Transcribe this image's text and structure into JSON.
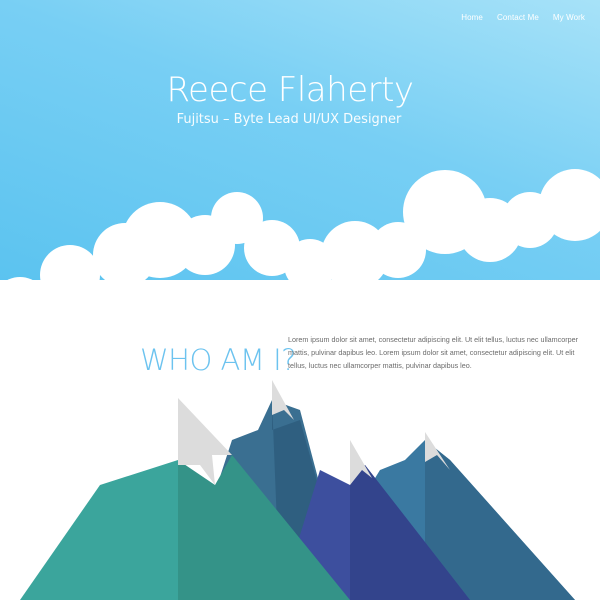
{
  "nav": {
    "items": [
      "Home",
      "Contact Me",
      "My Work"
    ]
  },
  "header": {
    "name": "Reece Flaherty",
    "role": "Fujitsu – Byte Lead UI/UX Designer"
  },
  "about": {
    "heading": "WHO AM I?",
    "text": "Lorem ipsum dolor sit amet, consectetur adipiscing elit. Ut elit tellus, luctus nec ullamcorper mattis, pulvinar dapibus leo. Lorem ipsum dolor sit amet, consectetur adipiscing elit. Ut elit tellus, luctus nec ullamcorper mattis, pulvinar dapibus leo."
  },
  "colors": {
    "sky_light": "#a7e2f8",
    "sky_dark": "#56c1ef",
    "heading_blue": "#6cc3ef",
    "mountain_teal": "#3ba59c",
    "mountain_blue": "#3a79a1",
    "mountain_indigo": "#3d4f9e",
    "snow": "#dcdcdc"
  }
}
